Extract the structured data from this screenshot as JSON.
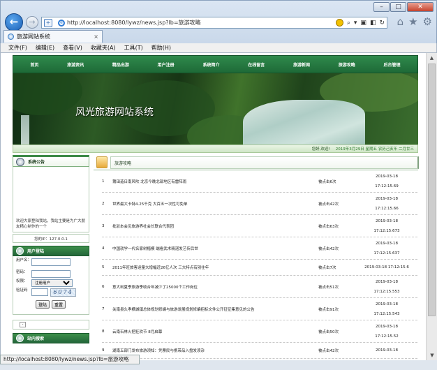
{
  "browser": {
    "url": "http://localhost:8080/lywz/news.jsp?lb=旅游攻略",
    "tab_title": "旅游网站系统",
    "tab_close": "×",
    "status_url": "http://localhost:8080/lywz/news.jsp?lb=旅游攻略",
    "menu": [
      "文件(F)",
      "编辑(E)",
      "查看(V)",
      "收藏夹(A)",
      "工具(T)",
      "帮助(H)"
    ]
  },
  "site": {
    "nav": [
      "首页",
      "旅游资讯",
      "精品出游",
      "用户注册",
      "系统简介",
      "在线留言",
      "旅游新闻",
      "旅游攻略",
      "后台管理"
    ],
    "banner_title": "风光旅游网站系统",
    "welcome": "您好,欢迎!",
    "date": "2019年3月29日 星期五 农历己亥年 二月廿三"
  },
  "notice": {
    "title": "系统公告",
    "text": "欢迎大家登陆我站，我站主要是为广大朋友精心制作的一个"
  },
  "ip": {
    "label": "您的IP：127.0.0.1"
  },
  "login": {
    "title": "用户登陆",
    "username_label": "用户名：",
    "password_label": "密码：",
    "role_label": "权限：",
    "role_value": "注册用户",
    "captcha_label": "验证码",
    "captcha_code": "6074",
    "login_button": "登陆",
    "reset_button": "重置"
  },
  "search": {
    "placeholder": "-"
  },
  "site_search": {
    "title": "站内搜索"
  },
  "news_section": {
    "title": "旅游攻略",
    "items": [
      {
        "num": "1",
        "title": "莆田造日南风吹 北京今晚北部地区有雷阵雨",
        "hits": "被点击6次",
        "time_top": "2019-03-18",
        "time_bottom": "17:12:15.69"
      },
      {
        "num": "2",
        "title": "世界最大卡特4.25千克 大百五一次性可免单",
        "hits": "被点击42次",
        "time_top": "2019-03-18",
        "time_bottom": "17:12:15.66"
      },
      {
        "num": "3",
        "title": "批驳本会见旅游界社会长联合代表团",
        "hits": "被点击63次",
        "time_top": "2019-03-18",
        "time_bottom": "17:12:15.673"
      },
      {
        "num": "4",
        "title": "中国就学一代名家树楷模 端看武术精湛发艺传后世",
        "hits": "被点击42次",
        "time_top": "2019-03-18",
        "time_bottom": "17:12:15.637"
      },
      {
        "num": "5",
        "title": "2011年旺旅客运量大增幅近26亿人次 三大特点有别往年",
        "hits": "被点击7次",
        "time_top": "2019-03-18 17:12:15.6",
        "time_bottom": ""
      },
      {
        "num": "6",
        "title": "意大利夏季旅游季收合年减少了25000个工作岗位",
        "hits": "被点击51次",
        "time_top": "2019-03-18",
        "time_bottom": "17:12:15.553"
      },
      {
        "num": "7",
        "title": "关南县久孝横城镇总体规划修编与旅游发展规划修编招标文件公开征征集意见的公告",
        "hits": "被点击91次",
        "time_top": "2019-03-18",
        "time_bottom": "17:12:15.543"
      },
      {
        "num": "8",
        "title": "云南石林火把狂欢节 8月启幕",
        "hits": "被点击50次",
        "time_top": "2019-03-18",
        "time_bottom": "17:12:15.52"
      },
      {
        "num": "9",
        "title": "湖南五部门发布旅游须知：凭票民与携带品入盘发须杂",
        "hits": "被点击42次",
        "time_top": "2019-03-18",
        "time_bottom": ""
      }
    ]
  }
}
